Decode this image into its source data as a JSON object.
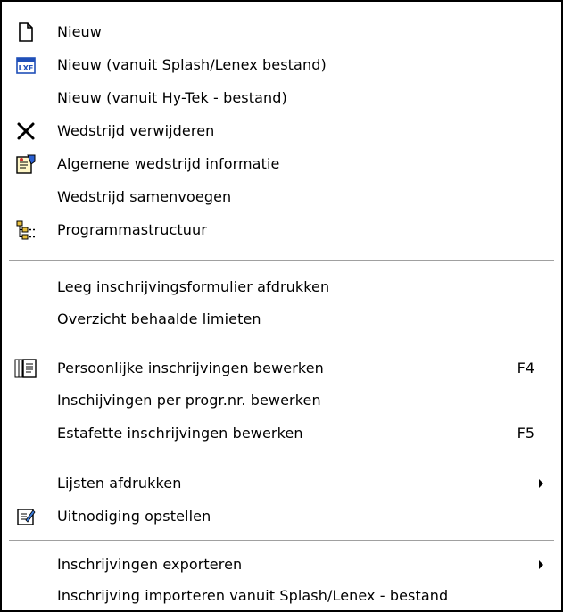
{
  "menu": {
    "items": [
      {
        "label": "Nieuw",
        "icon": "new-document-icon"
      },
      {
        "label": "Nieuw (vanuit Splash/Lenex bestand)",
        "icon": "lxf-file-icon"
      },
      {
        "label": "Nieuw (vanuit Hy-Tek - bestand)"
      },
      {
        "label": "Wedstrijd verwijderen",
        "icon": "delete-x-icon"
      },
      {
        "label": "Algemene wedstrijd informatie",
        "icon": "properties-icon"
      },
      {
        "label": "Wedstrijd samenvoegen"
      },
      {
        "label": "Programmastructuur",
        "icon": "tree-structure-icon"
      },
      {
        "label": "Leeg inschrijvingsformulier afdrukken"
      },
      {
        "label": "Overzicht behaalde limieten"
      },
      {
        "label": "Persoonlijke inschrijvingen bewerken",
        "icon": "documents-icon",
        "shortcut": "F4"
      },
      {
        "label": "Inschijvingen per progr.nr. bewerken"
      },
      {
        "label": "Estafette inschrijvingen bewerken",
        "shortcut": "F5"
      },
      {
        "label": "Lijsten afdrukken",
        "submenu": true
      },
      {
        "label": "Uitnodiging opstellen",
        "icon": "edit-form-icon"
      },
      {
        "label": "Inschrijvingen exporteren",
        "submenu": true
      },
      {
        "label": "Inschrijving importeren vanuit Splash/Lenex - bestand"
      }
    ]
  }
}
